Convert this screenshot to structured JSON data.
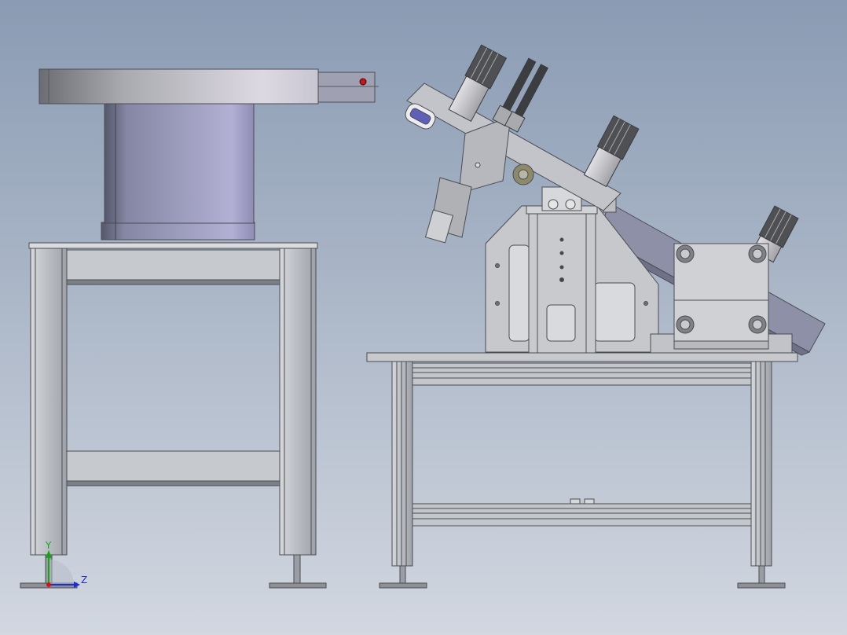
{
  "viewport": {
    "background_top": "#8a9bb3",
    "background_bottom": "#d2d7e0"
  },
  "colors": {
    "frame_metal": "#b9bcc2",
    "frame_dark": "#6f737a",
    "bowl_body": "#a5a6c6",
    "bowl_top": "#d7d5dd",
    "cylinder_dark": "#5a5b5e",
    "cylinder_light": "#c3c2c6",
    "chute": "#8e90a8",
    "plate": "#c7c8cc",
    "red_indicator": "#c4161c"
  },
  "triad": {
    "y_label": "Y",
    "z_label": "Z",
    "y_color": "#1aa31a",
    "z_color": "#1b2fd1",
    "origin_color": "#d0141a"
  },
  "icons": {
    "triad": "coordinate-axes-icon"
  }
}
